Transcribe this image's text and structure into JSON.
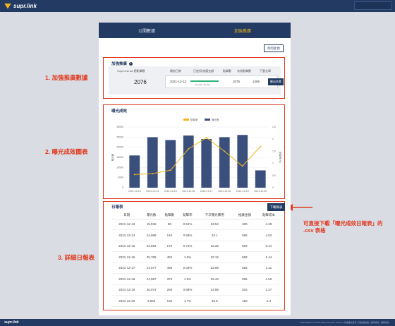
{
  "app": {
    "brand": "supr.link"
  },
  "tabs": [
    {
      "label": "公開數據"
    },
    {
      "label": "加強推廣"
    }
  ],
  "toolbar": {
    "print_label": "列印此頁"
  },
  "summary": {
    "title": "加強推廣",
    "labels": [
      "Supr.Link Ad 總點擊數",
      "開始日期",
      "已使用/推廣金額",
      "點擊數",
      "有效點擊數",
      "下載名單"
    ],
    "total_clicks": "2076",
    "start_date": "2021-12-13",
    "budget_text": "$6,000 / $6,000",
    "budget_progress": 1.0,
    "clicks": "2076",
    "valid_clicks": "1395",
    "download_button": "匯出名單"
  },
  "chart_section": {
    "title": "曝光成效"
  },
  "chart_data": {
    "type": "bar",
    "categories": [
      "2021-12-13",
      "2021-12-14",
      "2021-12-15",
      "2021-12-16",
      "2021-12-17",
      "2021-12-18",
      "2021-12-19",
      "2021-12-20"
    ],
    "series": [
      {
        "name": "曝光數",
        "type": "bar",
        "axis": "left",
        "values": [
          15945,
          24968,
          23563,
          25786,
          24077,
          24987,
          26074,
          8562
        ],
        "color": "#3b4f7d"
      },
      {
        "name": "點擊率",
        "type": "line",
        "axis": "right",
        "values": [
          0.54,
          0.58,
          0.72,
          1.6,
          2.06,
          1.5,
          0.89,
          1.7
        ],
        "color": "#f2b51e"
      }
    ],
    "ylim_left": [
      0,
      30000
    ],
    "yticks_left": [
      "0",
      "5000",
      "10000",
      "15000",
      "20000",
      "25000",
      "30000"
    ],
    "ylim_right": [
      0,
      2.5
    ],
    "yticks_right": [
      "0",
      "0.5",
      "1",
      "1.5",
      "2",
      "2.5"
    ],
    "ylabel_left": "曝光數",
    "ylabel_right": "點擊率(%)",
    "legend_position": "top-center",
    "grid": true
  },
  "daily": {
    "title": "日報表",
    "download_label": "下載報表",
    "headers": [
      "日期",
      "曝光數",
      "點擊數",
      "點擊率",
      "千次曝光費用",
      "推廣金額",
      "點擊成本"
    ],
    "rows": [
      [
        "2021-12-13",
        "15,945",
        "86",
        "0.54%",
        "33.54",
        "306",
        "4.28"
      ],
      [
        "2021-12-14",
        "24,968",
        "145",
        "0.58%",
        "33.1",
        "585",
        "4.03"
      ],
      [
        "2021-12-15",
        "23,563",
        "170",
        "0.72%",
        "23.25",
        "506",
        "3.14"
      ],
      [
        "2021-12-16",
        "25,786",
        "404",
        "1.6%",
        "23.12",
        "582",
        "1.44"
      ],
      [
        "2021-12-17",
        "24,077",
        "496",
        "2.06%",
        "22.59",
        "552",
        "1.11"
      ],
      [
        "2021-12-18",
        "24,987",
        "376",
        "1.5%",
        "23.44",
        "585",
        "1.56"
      ],
      [
        "2021-12-19",
        "26,074",
        "269",
        "0.89%",
        "23.59",
        "615",
        "2.37"
      ],
      [
        "2021-12-20",
        "8,562",
        "136",
        "1.7%",
        "33.8",
        "189",
        "1.4"
      ]
    ]
  },
  "annotations": {
    "a1": "1. 加強推廣數據",
    "a2": "2. 曝光成效圖表",
    "a3": "3. 詳細日報表",
    "note": "可直接下載「曝光成效日報表」的 .csv 表格"
  },
  "footer": {
    "brand": "supr.link",
    "text": "COPYRIGHT © 2016-2022 Supr.link | Chrome 外掛擴充套件 | 隱私權政策 | 使用條款 | 服務條款"
  }
}
